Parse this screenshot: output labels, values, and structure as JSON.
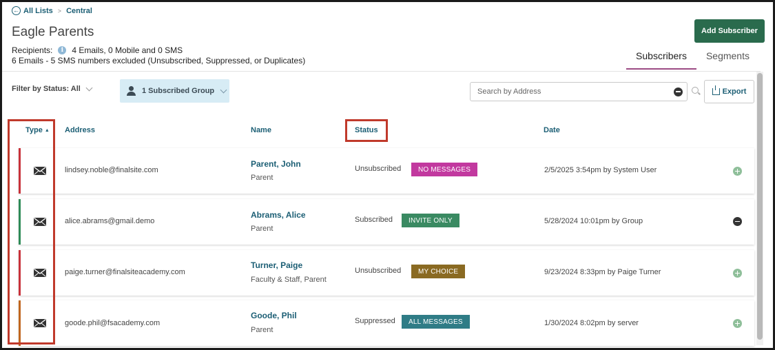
{
  "breadcrumb": {
    "back_label": "All Lists",
    "separator": ">",
    "current": "Central"
  },
  "page_title": "Eagle Parents",
  "recipients": {
    "label": "Recipients:",
    "summary": "4 Emails, 0 Mobile and 0 SMS",
    "excluded": "6 Emails - 5 SMS numbers excluded (Unsubscribed, Suppressed, or Duplicates)"
  },
  "actions": {
    "add_subscriber": "Add Subscriber",
    "export": "Export"
  },
  "tabs": [
    {
      "label": "Subscribers",
      "active": true
    },
    {
      "label": "Segments",
      "active": false
    }
  ],
  "filters": {
    "status_label": "Filter by Status: All",
    "group_label": "1 Subscribed Group"
  },
  "search": {
    "placeholder": "Search by Address",
    "value": ""
  },
  "table": {
    "columns": {
      "type": "Type",
      "address": "Address",
      "name": "Name",
      "status": "Status",
      "date": "Date"
    },
    "sort": {
      "column": "Type",
      "direction": "ascending"
    },
    "rows": [
      {
        "type_icon": "envelope-icon",
        "address": "lindsey.noble@finalsite.com",
        "name": "Parent, John",
        "role": "Parent",
        "status": "Unsubscribed",
        "badge": "NO MESSAGES",
        "badge_color": "#c2399f",
        "date": "2/5/2025 3:54pm by System User",
        "stripe_color": "#c8323a",
        "action": "add"
      },
      {
        "type_icon": "envelope-icon",
        "address": "alice.abrams@gmail.demo",
        "name": "Abrams, Alice",
        "role": "Parent",
        "status": "Subscribed",
        "badge": "INVITE ONLY",
        "badge_color": "#3a8a62",
        "date": "5/28/2024 10:01pm by Group",
        "stripe_color": "#2e8b57",
        "action": "remove"
      },
      {
        "type_icon": "envelope-icon",
        "address": "paige.turner@finalsiteacademy.com",
        "name": "Turner, Paige",
        "role": "Faculty & Staff, Parent",
        "status": "Unsubscribed",
        "badge": "MY CHOICE",
        "badge_color": "#8a6a22",
        "date": "9/23/2024 8:33pm by Paige Turner",
        "stripe_color": "#c8323a",
        "action": "add"
      },
      {
        "type_icon": "envelope-icon",
        "address": "goode.phil@fsacademy.com",
        "name": "Goode, Phil",
        "role": "Parent",
        "status": "Suppressed",
        "badge": "ALL MESSAGES",
        "badge_color": "#2f7c86",
        "date": "1/30/2024 8:02pm by server",
        "stripe_color": "#c0661f",
        "action": "add"
      }
    ]
  },
  "colors": {
    "link": "#1b5e74",
    "primary_button": "#2a6b4d",
    "highlight_box": "#c0392b",
    "group_pill_bg": "#d7ecf5"
  }
}
